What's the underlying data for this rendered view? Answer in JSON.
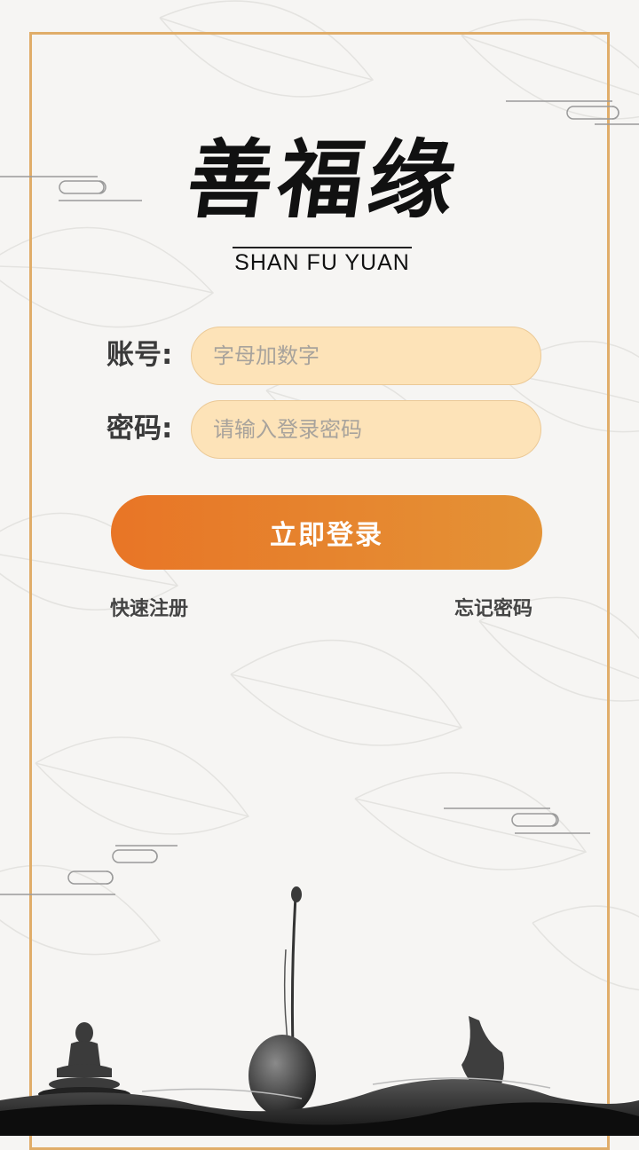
{
  "brand": {
    "title": "善福缘",
    "subtitle": "SHAN FU YUAN"
  },
  "form": {
    "account_label": "账号:",
    "account_placeholder": "字母加数字",
    "password_label": "密码:",
    "password_placeholder": "请输入登录密码",
    "login_label": "立即登录"
  },
  "links": {
    "register": "快速注册",
    "forgot": "忘记密码"
  },
  "colors": {
    "frame": "#e0ad69",
    "input_bg": "#fde3b8",
    "button_start": "#e87526",
    "button_end": "#e49336"
  }
}
